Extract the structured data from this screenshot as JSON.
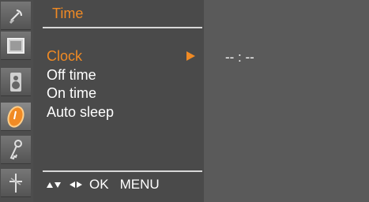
{
  "colors": {
    "accent": "#f08a24",
    "panel": "#4a4a4a",
    "background": "#5a5a5a"
  },
  "sidebar": {
    "icons": [
      {
        "name": "satellite-icon"
      },
      {
        "name": "picture-icon"
      },
      {
        "name": "speaker-icon"
      },
      {
        "name": "clock-icon",
        "active": true
      },
      {
        "name": "key-icon"
      },
      {
        "name": "antenna-icon"
      }
    ]
  },
  "menu": {
    "title": "Time",
    "items": [
      {
        "label": "Clock",
        "selected": true
      },
      {
        "label": "Off time"
      },
      {
        "label": "On time"
      },
      {
        "label": "Auto sleep"
      }
    ]
  },
  "footer": {
    "ok_label": "OK",
    "menu_label": "MENU"
  },
  "value_display": "-- : --"
}
